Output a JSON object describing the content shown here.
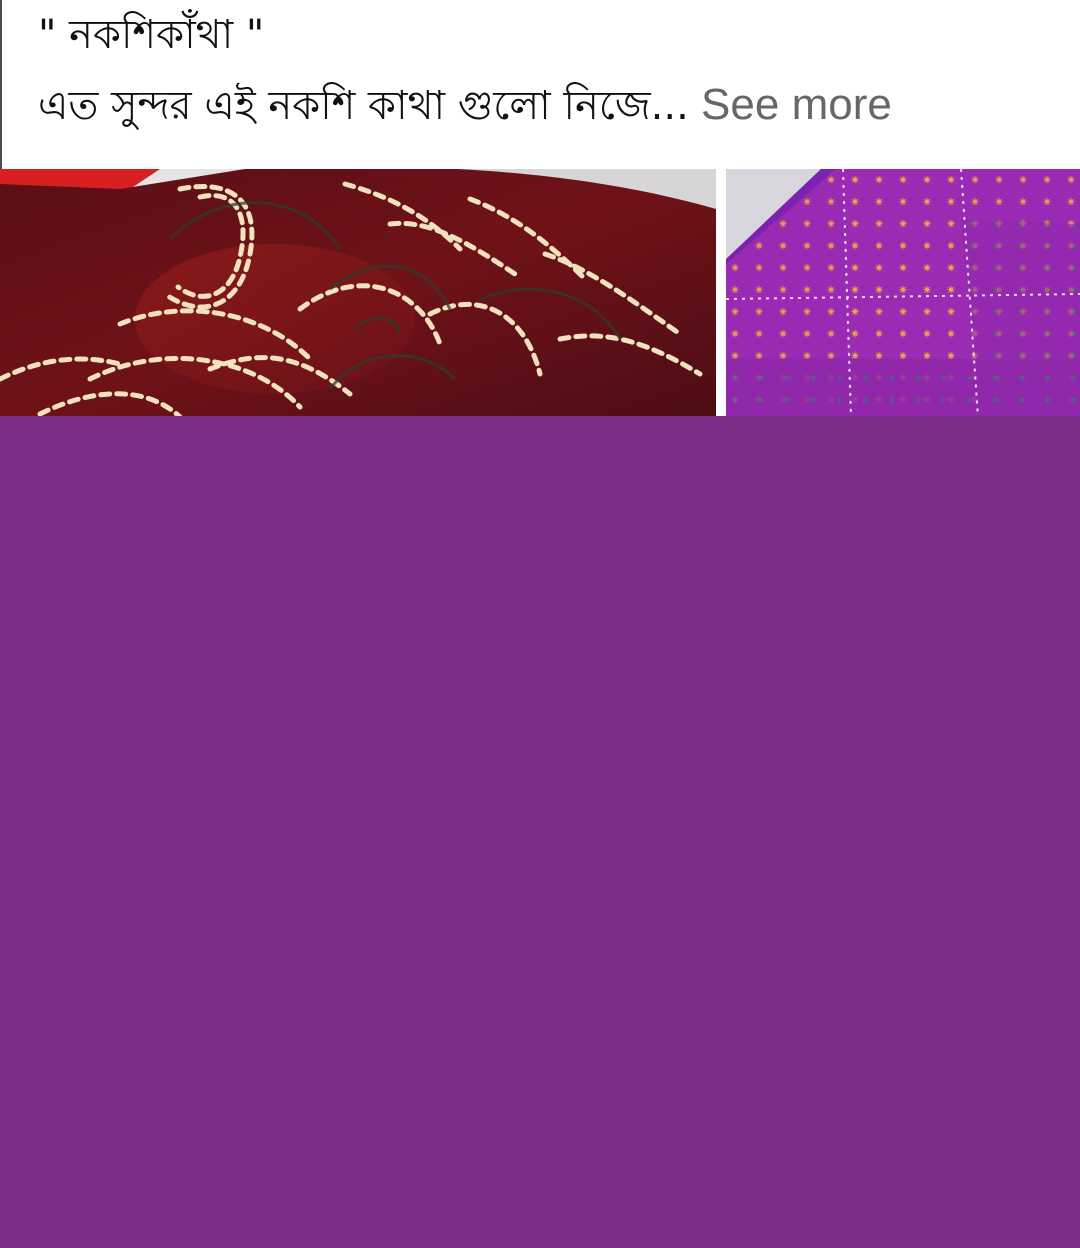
{
  "post": {
    "title": "\" নকশিকাঁথা \"",
    "body_preview": "এত সুন্দর  এই নকশি কাথা  গুলো  নিজে...",
    "see_more_label": " See more"
  },
  "media": {
    "images": [
      {
        "alt": "maroon-stitched-nakshi-kantha"
      },
      {
        "alt": "purple-floral-nakshi-kantha"
      }
    ]
  },
  "colors": {
    "accent_panel": "#7B2D87",
    "text_primary": "#111111",
    "text_secondary": "#65676B"
  }
}
